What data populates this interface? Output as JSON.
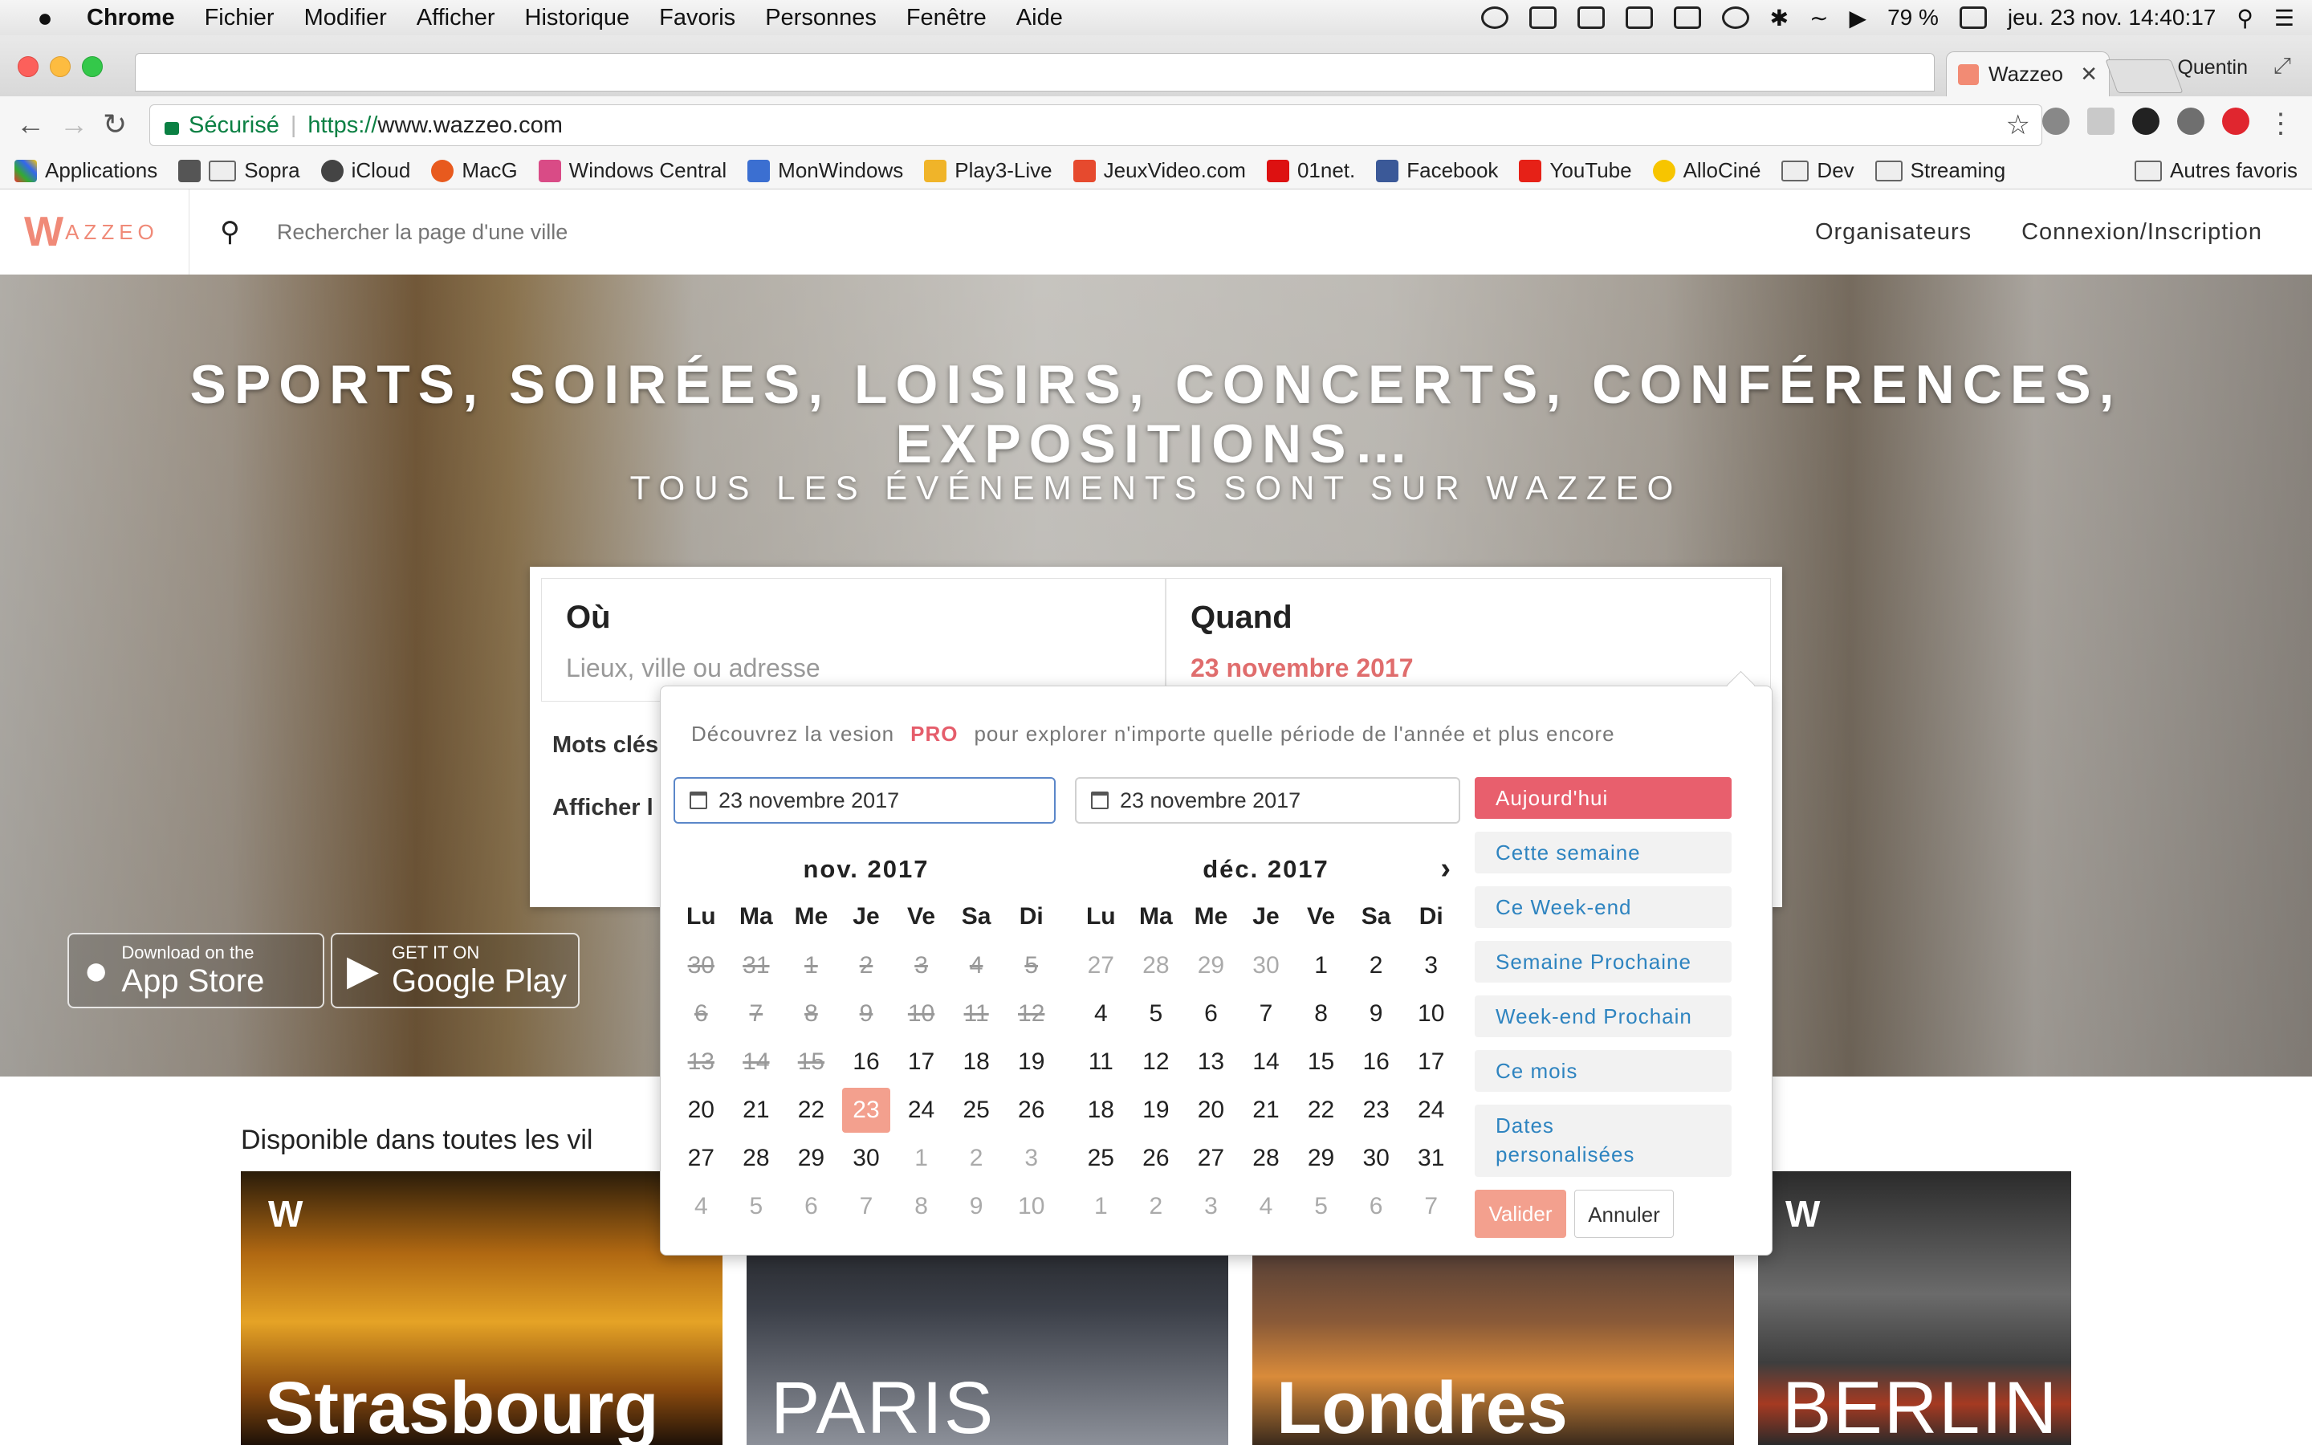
{
  "menubar": {
    "app": "Chrome",
    "items": [
      "Fichier",
      "Modifier",
      "Afficher",
      "Historique",
      "Favoris",
      "Personnes",
      "Fenêtre",
      "Aide"
    ],
    "battery": "79 %",
    "clock": "jeu. 23 nov.  14:40:17"
  },
  "browser": {
    "tab_title": "Wazzeo",
    "profile": "Quentin",
    "secure_label": "Sécurisé",
    "url_scheme": "https://",
    "url_host": "www.wazzeo.com"
  },
  "bookmarks": [
    "Applications",
    "Sopra",
    "iCloud",
    "MacG",
    "Windows Central",
    "MonWindows",
    "Play3-Live",
    "JeuxVideo.com",
    "01net.",
    "Facebook",
    "YouTube",
    "AlloCiné",
    "Dev",
    "Streaming"
  ],
  "bookmarks_other": "Autres favoris",
  "site": {
    "logo_w": "W",
    "logo_rest": "AZZEO",
    "search_placeholder": "Rechercher la page d'une ville",
    "nav": [
      "Organisateurs",
      "Connexion/Inscription"
    ]
  },
  "hero": {
    "title_line1": "SPORTS, SOIRÉES, LOISIRS, CONCERTS, CONFÉRENCES,",
    "title_line2": "EXPOSITIONS…",
    "subtitle": "TOUS LES ÉVÉNEMENTS SONT SUR WAZZEO",
    "appstore_small": "Download on the",
    "appstore_large": "App Store",
    "play_small": "GET IT ON",
    "play_large": "Google Play"
  },
  "search": {
    "where_label": "Où",
    "where_placeholder": "Lieux, ville ou adresse",
    "when_label": "Quand",
    "when_value": "23 novembre 2017",
    "keywords_label": "Mots clés",
    "show_label": "Afficher l"
  },
  "picker": {
    "pro_pre": "Découvrez la vesion",
    "pro_word": "PRO",
    "pro_post": "pour explorer n'importe quelle période de l'année et plus encore",
    "start": "23 novembre 2017",
    "end": "23 novembre 2017",
    "weekdays": [
      "Lu",
      "Ma",
      "Me",
      "Je",
      "Ve",
      "Sa",
      "Di"
    ],
    "month1": {
      "title": "nov. 2017",
      "days": [
        {
          "d": "30",
          "s": "past"
        },
        {
          "d": "31",
          "s": "past"
        },
        {
          "d": "1",
          "s": "past"
        },
        {
          "d": "2",
          "s": "past"
        },
        {
          "d": "3",
          "s": "past"
        },
        {
          "d": "4",
          "s": "past"
        },
        {
          "d": "5",
          "s": "past"
        },
        {
          "d": "6",
          "s": "past"
        },
        {
          "d": "7",
          "s": "past"
        },
        {
          "d": "8",
          "s": "past"
        },
        {
          "d": "9",
          "s": "past"
        },
        {
          "d": "10",
          "s": "past"
        },
        {
          "d": "11",
          "s": "past"
        },
        {
          "d": "12",
          "s": "past"
        },
        {
          "d": "13",
          "s": "past"
        },
        {
          "d": "14",
          "s": "past"
        },
        {
          "d": "15",
          "s": "past"
        },
        {
          "d": "16",
          "s": ""
        },
        {
          "d": "17",
          "s": ""
        },
        {
          "d": "18",
          "s": ""
        },
        {
          "d": "19",
          "s": ""
        },
        {
          "d": "20",
          "s": ""
        },
        {
          "d": "21",
          "s": ""
        },
        {
          "d": "22",
          "s": ""
        },
        {
          "d": "23",
          "s": "sel"
        },
        {
          "d": "24",
          "s": ""
        },
        {
          "d": "25",
          "s": ""
        },
        {
          "d": "26",
          "s": ""
        },
        {
          "d": "27",
          "s": ""
        },
        {
          "d": "28",
          "s": ""
        },
        {
          "d": "29",
          "s": ""
        },
        {
          "d": "30",
          "s": ""
        },
        {
          "d": "1",
          "s": "off"
        },
        {
          "d": "2",
          "s": "off"
        },
        {
          "d": "3",
          "s": "off"
        },
        {
          "d": "4",
          "s": "off"
        },
        {
          "d": "5",
          "s": "off"
        },
        {
          "d": "6",
          "s": "off"
        },
        {
          "d": "7",
          "s": "off"
        },
        {
          "d": "8",
          "s": "off"
        },
        {
          "d": "9",
          "s": "off"
        },
        {
          "d": "10",
          "s": "off"
        }
      ]
    },
    "month2": {
      "title": "déc. 2017",
      "days": [
        {
          "d": "27",
          "s": "off"
        },
        {
          "d": "28",
          "s": "off"
        },
        {
          "d": "29",
          "s": "off"
        },
        {
          "d": "30",
          "s": "off"
        },
        {
          "d": "1",
          "s": ""
        },
        {
          "d": "2",
          "s": ""
        },
        {
          "d": "3",
          "s": ""
        },
        {
          "d": "4",
          "s": ""
        },
        {
          "d": "5",
          "s": ""
        },
        {
          "d": "6",
          "s": ""
        },
        {
          "d": "7",
          "s": ""
        },
        {
          "d": "8",
          "s": ""
        },
        {
          "d": "9",
          "s": ""
        },
        {
          "d": "10",
          "s": ""
        },
        {
          "d": "11",
          "s": ""
        },
        {
          "d": "12",
          "s": ""
        },
        {
          "d": "13",
          "s": ""
        },
        {
          "d": "14",
          "s": ""
        },
        {
          "d": "15",
          "s": ""
        },
        {
          "d": "16",
          "s": ""
        },
        {
          "d": "17",
          "s": ""
        },
        {
          "d": "18",
          "s": ""
        },
        {
          "d": "19",
          "s": ""
        },
        {
          "d": "20",
          "s": ""
        },
        {
          "d": "21",
          "s": ""
        },
        {
          "d": "22",
          "s": ""
        },
        {
          "d": "23",
          "s": ""
        },
        {
          "d": "24",
          "s": ""
        },
        {
          "d": "25",
          "s": ""
        },
        {
          "d": "26",
          "s": ""
        },
        {
          "d": "27",
          "s": ""
        },
        {
          "d": "28",
          "s": ""
        },
        {
          "d": "29",
          "s": ""
        },
        {
          "d": "30",
          "s": ""
        },
        {
          "d": "31",
          "s": ""
        },
        {
          "d": "1",
          "s": "off"
        },
        {
          "d": "2",
          "s": "off"
        },
        {
          "d": "3",
          "s": "off"
        },
        {
          "d": "4",
          "s": "off"
        },
        {
          "d": "5",
          "s": "off"
        },
        {
          "d": "6",
          "s": "off"
        },
        {
          "d": "7",
          "s": "off"
        }
      ]
    },
    "quick": [
      "Aujourd'hui",
      "Cette semaine",
      "Ce Week-end",
      "Semaine Prochaine",
      "Week-end Prochain",
      "Ce mois"
    ],
    "quick_custom_1": "Dates",
    "quick_custom_2": "personalisées",
    "validate": "Valider",
    "cancel": "Annuler"
  },
  "cities": {
    "heading": "Disponible dans toutes les vil",
    "names": [
      "Strasbourg",
      "PARIS",
      "Londres",
      "BERLIN"
    ]
  },
  "colors": {
    "brand": "#f08a78",
    "accent_red": "#e85f6d",
    "link_blue": "#2e84c0",
    "selected_day": "#f3a08e"
  }
}
